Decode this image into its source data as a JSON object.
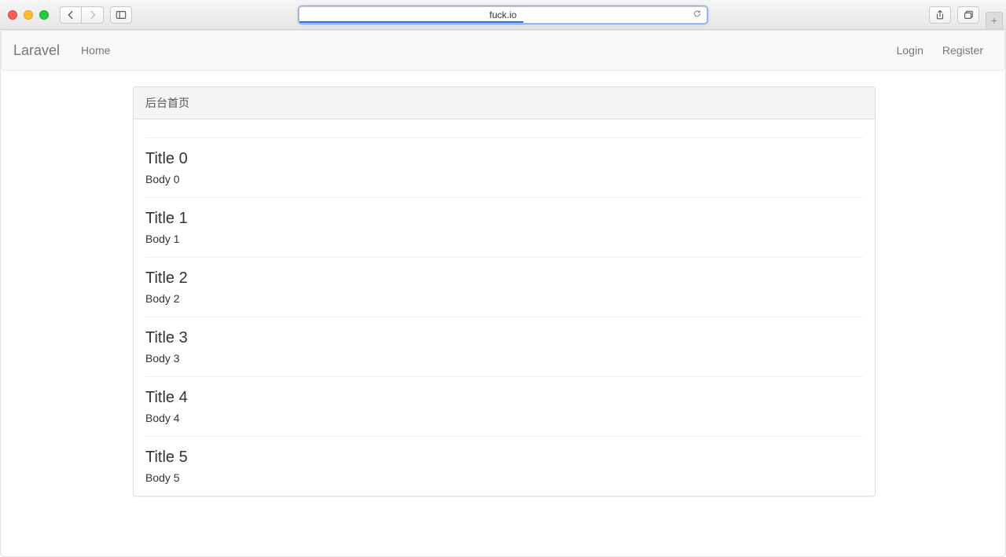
{
  "browser": {
    "url": "fuck.io"
  },
  "navbar": {
    "brand": "Laravel",
    "left": [
      {
        "label": "Home"
      }
    ],
    "right": [
      {
        "label": "Login"
      },
      {
        "label": "Register"
      }
    ]
  },
  "panel": {
    "heading": "后台首页"
  },
  "posts": [
    {
      "title": "Title 0",
      "body": "Body 0"
    },
    {
      "title": "Title 1",
      "body": "Body 1"
    },
    {
      "title": "Title 2",
      "body": "Body 2"
    },
    {
      "title": "Title 3",
      "body": "Body 3"
    },
    {
      "title": "Title 4",
      "body": "Body 4"
    },
    {
      "title": "Title 5",
      "body": "Body 5"
    }
  ]
}
